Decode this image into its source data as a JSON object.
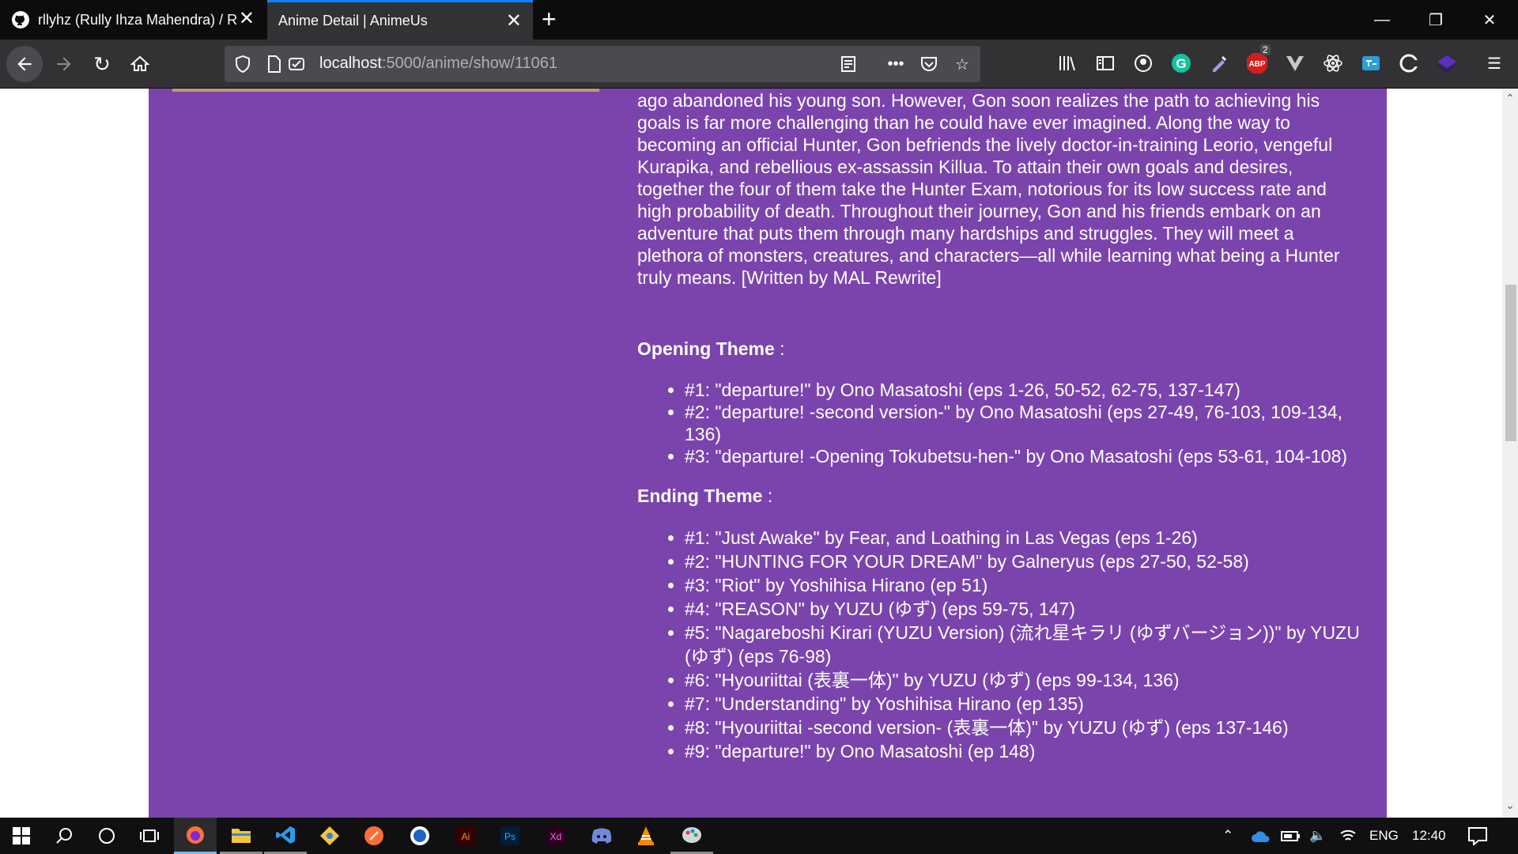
{
  "browser": {
    "tabs": [
      {
        "title": "rllyhz (Rully Ihza Mahendra) / R",
        "active": false,
        "icon": "github-icon"
      },
      {
        "title": "Anime Detail | AnimeUs",
        "active": true,
        "icon": ""
      }
    ],
    "url_host": "localhost",
    "url_path": ":5000/anime/show/11061",
    "abp_badge": "2"
  },
  "page": {
    "synopsis": "ago abandoned his young son. However, Gon soon realizes the path to achieving his goals is far more challenging than he could have ever imagined. Along the way to becoming an official Hunter, Gon befriends the lively doctor-in-training Leorio, vengeful Kurapika, and rebellious ex-assassin Killua. To attain their own goals and desires, together the four of them take the Hunter Exam, notorious for its low success rate and high probability of death. Throughout their journey, Gon and his friends embark on an adventure that puts them through many hardships and struggles. They will meet a plethora of monsters, creatures, and characters—all while learning what being a Hunter truly means. [Written by MAL Rewrite]",
    "opening_label": "Opening Theme",
    "opening": [
      "#1: \"departure!\" by Ono Masatoshi (eps 1-26, 50-52, 62-75, 137-147)",
      "#2: \"departure! -second version-\" by Ono Masatoshi (eps 27-49, 76-103, 109-134, 136)",
      "#3: \"departure! -Opening Tokubetsu-hen-\" by Ono Masatoshi (eps 53-61, 104-108)"
    ],
    "ending_label": "Ending Theme",
    "ending": [
      "#1: \"Just Awake\" by Fear, and Loathing in Las Vegas (eps 1-26)",
      "#2: \"HUNTING FOR YOUR DREAM\" by Galneryus (eps 27-50, 52-58)",
      "#3: \"Riot\" by Yoshihisa Hirano (ep 51)",
      "#4: \"REASON\" by YUZU (ゆず) (eps 59-75, 147)",
      "#5: \"Nagareboshi Kirari (YUZU Version) (流れ星キラリ (ゆずバージョン))\" by YUZU (ゆず) (eps 76-98)",
      "#6: \"Hyouriittai (表裏一体)\" by YUZU (ゆず) (eps 99-134, 136)",
      "#7: \"Understanding\" by Yoshihisa Hirano (ep 135)",
      "#8: \"Hyouriittai -second version- (表裏一体)\" by YUZU (ゆず) (eps 137-146)",
      "#9: \"departure!\" by Ono Masatoshi (ep 148)"
    ]
  },
  "taskbar": {
    "language": "ENG",
    "time": "12:40"
  },
  "colors": {
    "card_bg": "#7b44ad",
    "tab_active_accent": "#0a84ff"
  }
}
